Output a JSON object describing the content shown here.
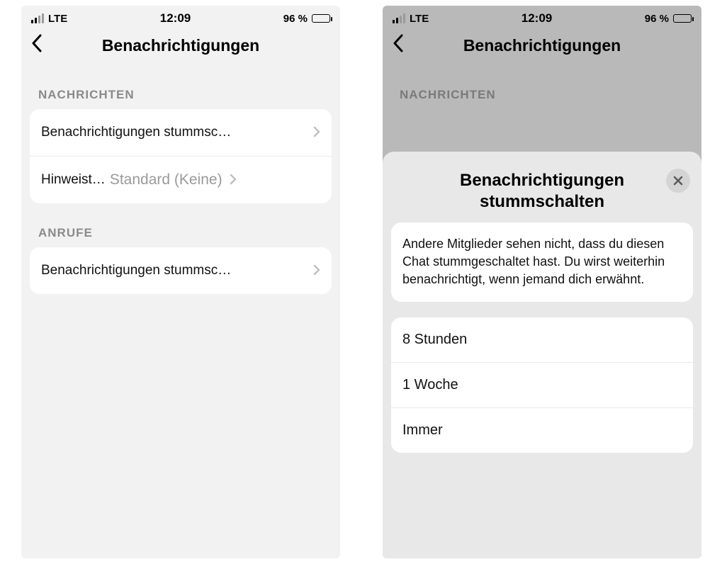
{
  "status": {
    "carrier": "LTE",
    "time": "12:09",
    "battery_text": "96 %"
  },
  "screen1": {
    "title": "Benachrichtigungen",
    "section_messages": "NACHRICHTEN",
    "row_mute": "Benachrichtigungen stummsc…",
    "row_hint_label": "Hinweist…",
    "row_hint_value": "Standard (Keine)",
    "section_calls": "ANRUFE",
    "row_calls_mute": "Benachrichtigungen stummsc…"
  },
  "screen2": {
    "title": "Benachrichtigungen",
    "section_messages": "NACHRICHTEN",
    "sheet_title": "Benachrichtigungen stummschalten",
    "sheet_info": "Andere Mitglieder sehen nicht, dass du diesen Chat stummgeschaltet hast. Du wirst weiterhin benachrichtigt, wenn jemand dich erwähnt.",
    "option_8h": "8 Stunden",
    "option_1w": "1 Woche",
    "option_always": "Immer"
  }
}
